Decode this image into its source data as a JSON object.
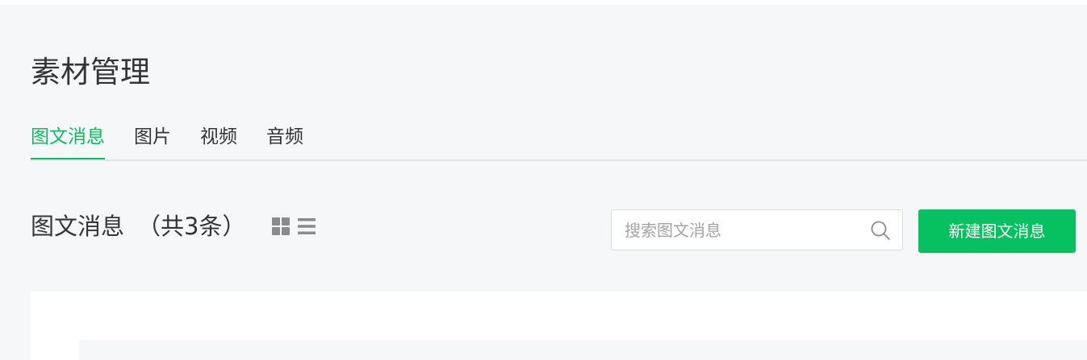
{
  "header": {
    "title": "素材管理"
  },
  "tabs": [
    {
      "label": "图文消息",
      "active": true
    },
    {
      "label": "图片",
      "active": false
    },
    {
      "label": "视频",
      "active": false
    },
    {
      "label": "音频",
      "active": false
    }
  ],
  "section": {
    "title": "图文消息",
    "count_text": "（共3条）"
  },
  "view_toggle": {
    "icons": [
      "grid-view-icon",
      "list-view-icon"
    ]
  },
  "search": {
    "value": "",
    "placeholder": "搜索图文消息",
    "icon": "search-icon"
  },
  "toolbar": {
    "create_label": "新建图文消息"
  },
  "colors": {
    "accent": "#07c160",
    "text": "#353535",
    "page_background": "#f6f7f9"
  }
}
